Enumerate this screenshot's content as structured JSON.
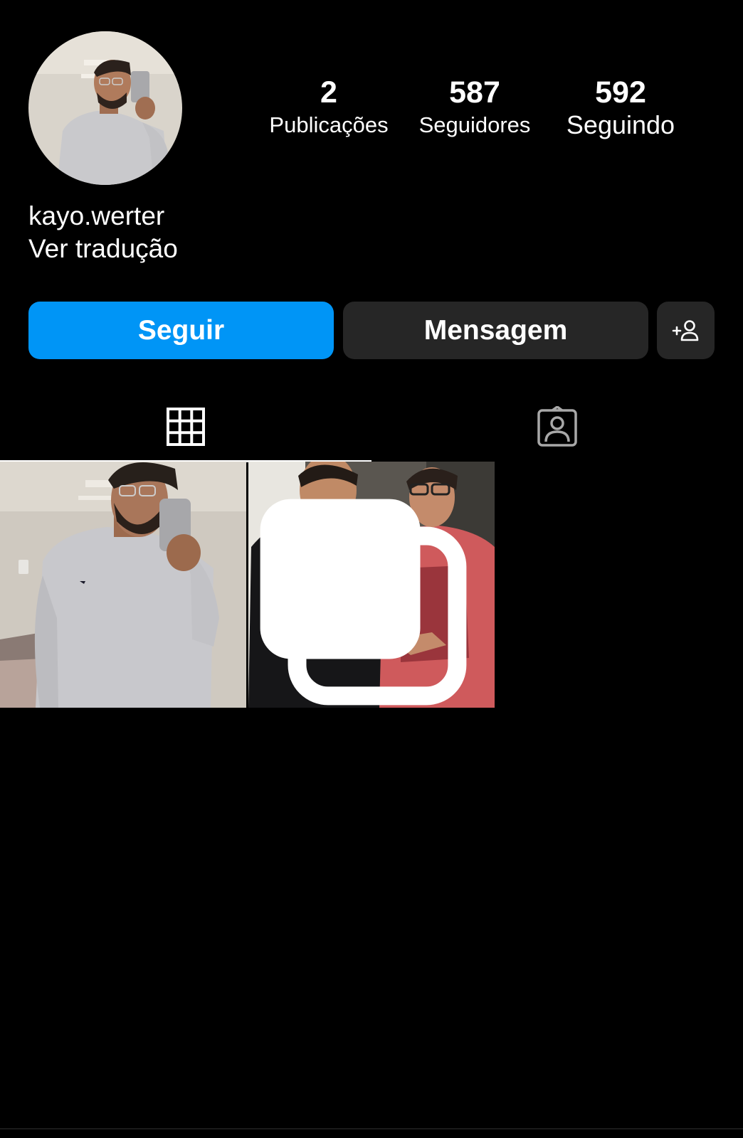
{
  "profile": {
    "username": "kayo.werter",
    "translate_link": "Ver tradução",
    "avatar_alt": "avatar"
  },
  "stats": {
    "posts": {
      "value": "2",
      "label": "Publicações"
    },
    "followers": {
      "value": "587",
      "label": "Seguidores"
    },
    "following": {
      "value": "592",
      "label": "Seguindo"
    }
  },
  "actions": {
    "follow_label": "Seguir",
    "message_label": "Mensagem",
    "suggest_icon": "add-person-icon"
  },
  "tabs": [
    {
      "name": "posts-grid",
      "icon": "grid-icon",
      "active": true
    },
    {
      "name": "tagged",
      "icon": "tagged-person-icon",
      "active": false
    }
  ],
  "posts": [
    {
      "description": "mirror selfie in grey long sleeve shirt",
      "multi": false
    },
    {
      "description": "two friends posing together",
      "multi": true
    }
  ],
  "colors": {
    "background": "#000000",
    "primary": "#0095f6",
    "secondary_button": "#262626",
    "text": "#ffffff"
  }
}
